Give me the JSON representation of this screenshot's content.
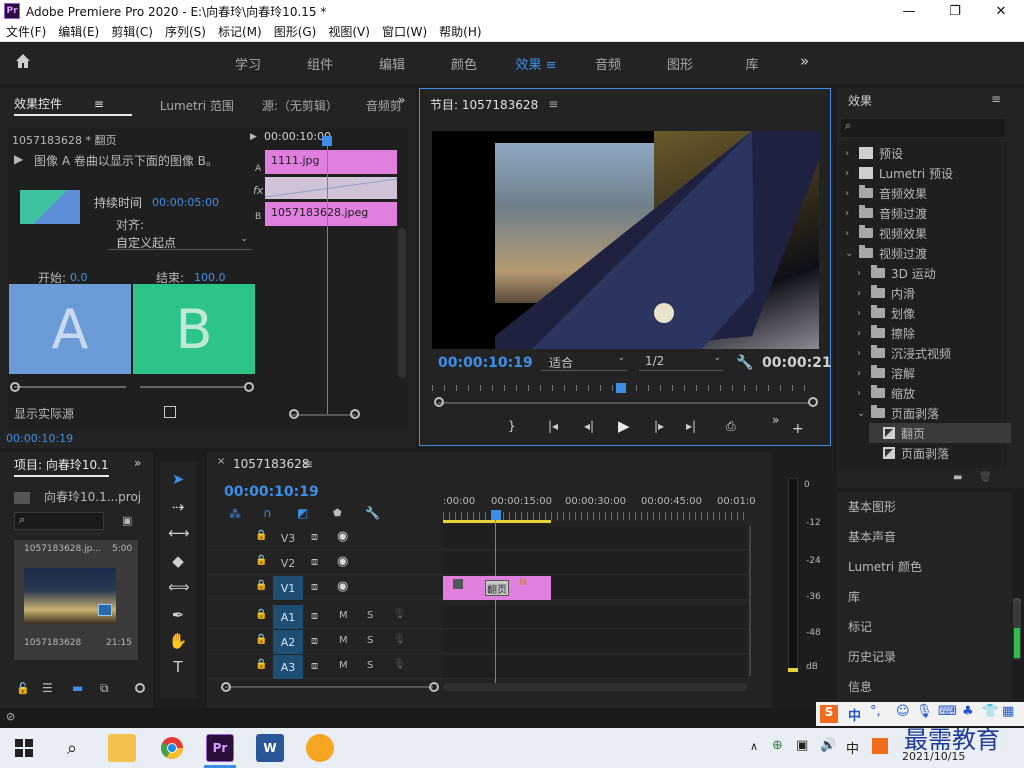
{
  "window": {
    "app_icon": "Pr",
    "title": "Adobe Premiere Pro 2020 - E:\\向春玲\\向春玲10.15 *",
    "minimize": "—",
    "maximize": "❐",
    "close": "✕"
  },
  "menu": [
    "文件(F)",
    "编辑(E)",
    "剪辑(C)",
    "序列(S)",
    "标记(M)",
    "图形(G)",
    "视图(V)",
    "窗口(W)",
    "帮助(H)"
  ],
  "workspaces": {
    "tabs": [
      "学习",
      "组件",
      "编辑",
      "颜色",
      "效果",
      "音频",
      "图形",
      "库"
    ],
    "active": "效果",
    "more": "»"
  },
  "effect_controls": {
    "tabs": [
      "效果控件",
      "Lumetri 范围",
      "源:（无剪辑）",
      "音频剪"
    ],
    "clip": "1057183628 * 翻页",
    "description": "图像 A 卷曲以显示下面的图像 B。",
    "duration_label": "持续时间",
    "duration_value": "00:00:05:00",
    "align_label": "对齐:",
    "align_value": "自定义起点",
    "start_label": "开始:",
    "start_value": "0.0",
    "end_label": "结束:",
    "end_value": "100.0",
    "a_label": "A",
    "b_label": "B",
    "show_actual_label": "显示实际源",
    "timecode": "00:00:10:00",
    "clip_a": "1111.jpg",
    "clip_b": "1057183628.jpeg",
    "track_a": "A",
    "track_fx": "fx",
    "track_b": "B",
    "bottom_timecode": "00:00:10:19"
  },
  "program": {
    "title": "节目: 1057183628",
    "timecode": "00:00:10:19",
    "fit": "适合",
    "resolution": "1/2",
    "duration": "00:00:21"
  },
  "effects_panel": {
    "title": "效果",
    "items": [
      {
        "label": "预设",
        "level": 0,
        "expanded": false,
        "type": "preset"
      },
      {
        "label": "Lumetri 预设",
        "level": 0,
        "expanded": false,
        "type": "preset"
      },
      {
        "label": "音频效果",
        "level": 0,
        "expanded": false,
        "type": "folder"
      },
      {
        "label": "音频过渡",
        "level": 0,
        "expanded": false,
        "type": "folder"
      },
      {
        "label": "视频效果",
        "level": 0,
        "expanded": false,
        "type": "folder"
      },
      {
        "label": "视频过渡",
        "level": 0,
        "expanded": true,
        "type": "folder"
      },
      {
        "label": "3D 运动",
        "level": 1,
        "expanded": false,
        "type": "folder"
      },
      {
        "label": "内滑",
        "level": 1,
        "expanded": false,
        "type": "folder"
      },
      {
        "label": "划像",
        "level": 1,
        "expanded": false,
        "type": "folder"
      },
      {
        "label": "擦除",
        "level": 1,
        "expanded": false,
        "type": "folder"
      },
      {
        "label": "沉浸式视频",
        "level": 1,
        "expanded": false,
        "type": "folder"
      },
      {
        "label": "溶解",
        "level": 1,
        "expanded": false,
        "type": "folder"
      },
      {
        "label": "缩放",
        "level": 1,
        "expanded": false,
        "type": "folder"
      },
      {
        "label": "页面剥落",
        "level": 1,
        "expanded": true,
        "type": "folder"
      },
      {
        "label": "翻页",
        "level": 2,
        "expanded": false,
        "type": "effect",
        "selected": true
      },
      {
        "label": "页面剥落",
        "level": 2,
        "expanded": false,
        "type": "effect"
      }
    ],
    "panels": [
      "基本图形",
      "基本声音",
      "Lumetri 颜色",
      "库",
      "标记",
      "历史记录",
      "信息"
    ]
  },
  "project": {
    "title": "项目: 向春玲10.1",
    "file": "向春玲10.1...proj",
    "thumb_top": "1057183628.jp...",
    "thumb_top_dur": "5:00",
    "thumb_name": "1057183628",
    "thumb_dur": "21:15"
  },
  "timeline": {
    "sequence": "1057183628",
    "timecode": "00:00:10:19",
    "ruler": [
      ":00:00",
      "00:00:15:00",
      "00:00:30:00",
      "00:00:45:00",
      "00:01:0"
    ],
    "tracks": [
      "V3",
      "V2",
      "V1",
      "A1",
      "A2",
      "A3"
    ],
    "mute": "M",
    "solo": "S",
    "transition_label": "翻页",
    "fx": "fx"
  },
  "meter": {
    "labels": [
      "0",
      "-12",
      "-24",
      "-36",
      "-48",
      "dB"
    ]
  },
  "taskbar": {
    "ime_label": "中",
    "time": "2021/10/15",
    "watermark": "最需教育"
  }
}
